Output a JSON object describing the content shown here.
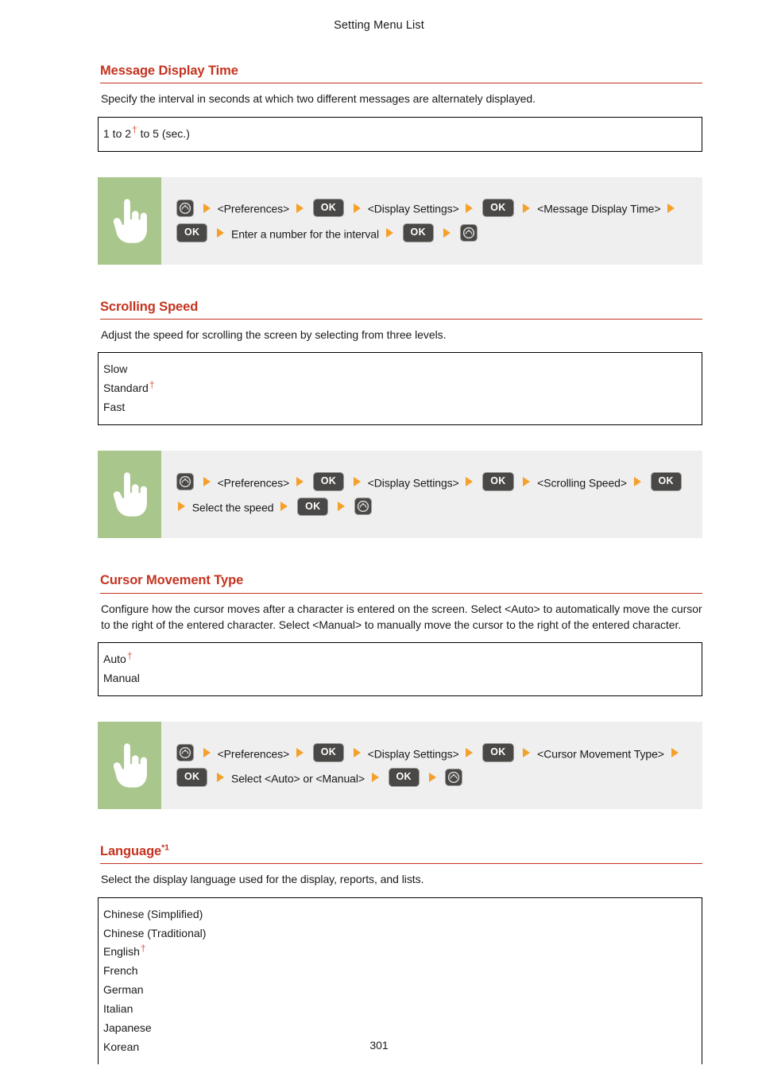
{
  "header": {
    "running_title": "Setting Menu List"
  },
  "footer": {
    "page_number": "301"
  },
  "sections": [
    {
      "id": "message-display-time",
      "heading": "Message Display Time",
      "heading_sup": "",
      "description": "Specify the interval in seconds at which two different messages are alternately displayed.",
      "options": [
        {
          "label": "1 to 2",
          "default": true,
          "suffix": "to 5 (sec.)"
        }
      ],
      "procedure": {
        "icon": "hand-pointer-icon",
        "steps": [
          {
            "type": "home-key",
            "label": "Home"
          },
          {
            "type": "text",
            "label": "<Preferences>"
          },
          {
            "type": "ok-key",
            "label": "OK"
          },
          {
            "type": "text",
            "label": "<Display Settings>"
          },
          {
            "type": "ok-key",
            "label": "OK"
          },
          {
            "type": "text",
            "label": "<Message Display Time>"
          },
          {
            "type": "ok-key",
            "label": "OK"
          },
          {
            "type": "text",
            "label": "Enter a number for the interval"
          },
          {
            "type": "ok-key",
            "label": "OK"
          },
          {
            "type": "home-key",
            "label": "Home"
          }
        ]
      }
    },
    {
      "id": "scrolling-speed",
      "heading": "Scrolling Speed",
      "heading_sup": "",
      "description": "Adjust the speed for scrolling the screen by selecting from three levels.",
      "options": [
        {
          "label": "Slow",
          "default": false
        },
        {
          "label": "Standard",
          "default": true
        },
        {
          "label": "Fast",
          "default": false
        }
      ],
      "procedure": {
        "icon": "hand-pointer-icon",
        "steps": [
          {
            "type": "home-key",
            "label": "Home"
          },
          {
            "type": "text",
            "label": "<Preferences>"
          },
          {
            "type": "ok-key",
            "label": "OK"
          },
          {
            "type": "text",
            "label": "<Display Settings>"
          },
          {
            "type": "ok-key",
            "label": "OK"
          },
          {
            "type": "text",
            "label": "<Scrolling Speed>"
          },
          {
            "type": "ok-key",
            "label": "OK"
          },
          {
            "type": "text",
            "label": "Select the speed"
          },
          {
            "type": "ok-key",
            "label": "OK"
          },
          {
            "type": "home-key",
            "label": "Home"
          }
        ]
      }
    },
    {
      "id": "cursor-movement-type",
      "heading": "Cursor Movement Type",
      "heading_sup": "",
      "description": "Configure how the cursor moves after a character is entered on the screen. Select <Auto> to automatically move the cursor to the right of the entered character. Select <Manual> to manually move the cursor to the right of the entered character.",
      "options": [
        {
          "label": "Auto",
          "default": true
        },
        {
          "label": "Manual",
          "default": false
        }
      ],
      "procedure": {
        "icon": "hand-pointer-icon",
        "steps": [
          {
            "type": "home-key",
            "label": "Home"
          },
          {
            "type": "text",
            "label": "<Preferences>"
          },
          {
            "type": "ok-key",
            "label": "OK"
          },
          {
            "type": "text",
            "label": "<Display Settings>"
          },
          {
            "type": "ok-key",
            "label": "OK"
          },
          {
            "type": "text",
            "label": "<Cursor Movement Type>"
          },
          {
            "type": "ok-key",
            "label": "OK"
          },
          {
            "type": "text",
            "label": "Select <Auto> or <Manual>"
          },
          {
            "type": "ok-key",
            "label": "OK"
          },
          {
            "type": "home-key",
            "label": "Home"
          }
        ]
      }
    },
    {
      "id": "language",
      "heading": "Language",
      "heading_sup": "*1",
      "description": "Select the display language used for the display, reports, and lists.",
      "options": [
        {
          "label": "Chinese (Simplified)",
          "default": false
        },
        {
          "label": "Chinese (Traditional)",
          "default": false
        },
        {
          "label": "English",
          "default": true
        },
        {
          "label": "French",
          "default": false
        },
        {
          "label": "German",
          "default": false
        },
        {
          "label": "Italian",
          "default": false
        },
        {
          "label": "Japanese",
          "default": false
        },
        {
          "label": "Korean",
          "default": false
        }
      ],
      "truncated": true
    }
  ],
  "colors": {
    "heading_red": "#C4331F",
    "dagger_red": "#E0593F",
    "panel_gray": "#EFEFEF",
    "icon_green": "#A9C78C",
    "key_dark": "#4A4846",
    "arrow_orange": "#F5A02A"
  },
  "flow_text": {
    "s0_line1_a": "<Preferences>",
    "s0_line1_b": "<Display Settings>",
    "s0_line1_c": "<Message Display",
    "s0_line2_a": "Time>",
    "s0_line2_b": "Enter a number for the interval",
    "s1_line1_a": "<Preferences>",
    "s1_line1_b": "<Display Settings>",
    "s1_line1_c": "<Scrolling",
    "s1_line2_a": "Speed>",
    "s1_line2_b": "Select the speed",
    "s2_line1_a": "<Preferences>",
    "s2_line1_b": "<Display Settings>",
    "s2_line1_c": "<Cursor Movement",
    "s2_line2_a": "Type>",
    "s2_line2_b": "Select <Auto> or <Manual>",
    "ok": "OK",
    "spec_1": "1 to 2",
    "spec_1_suffix": "to 5 (sec.)"
  }
}
